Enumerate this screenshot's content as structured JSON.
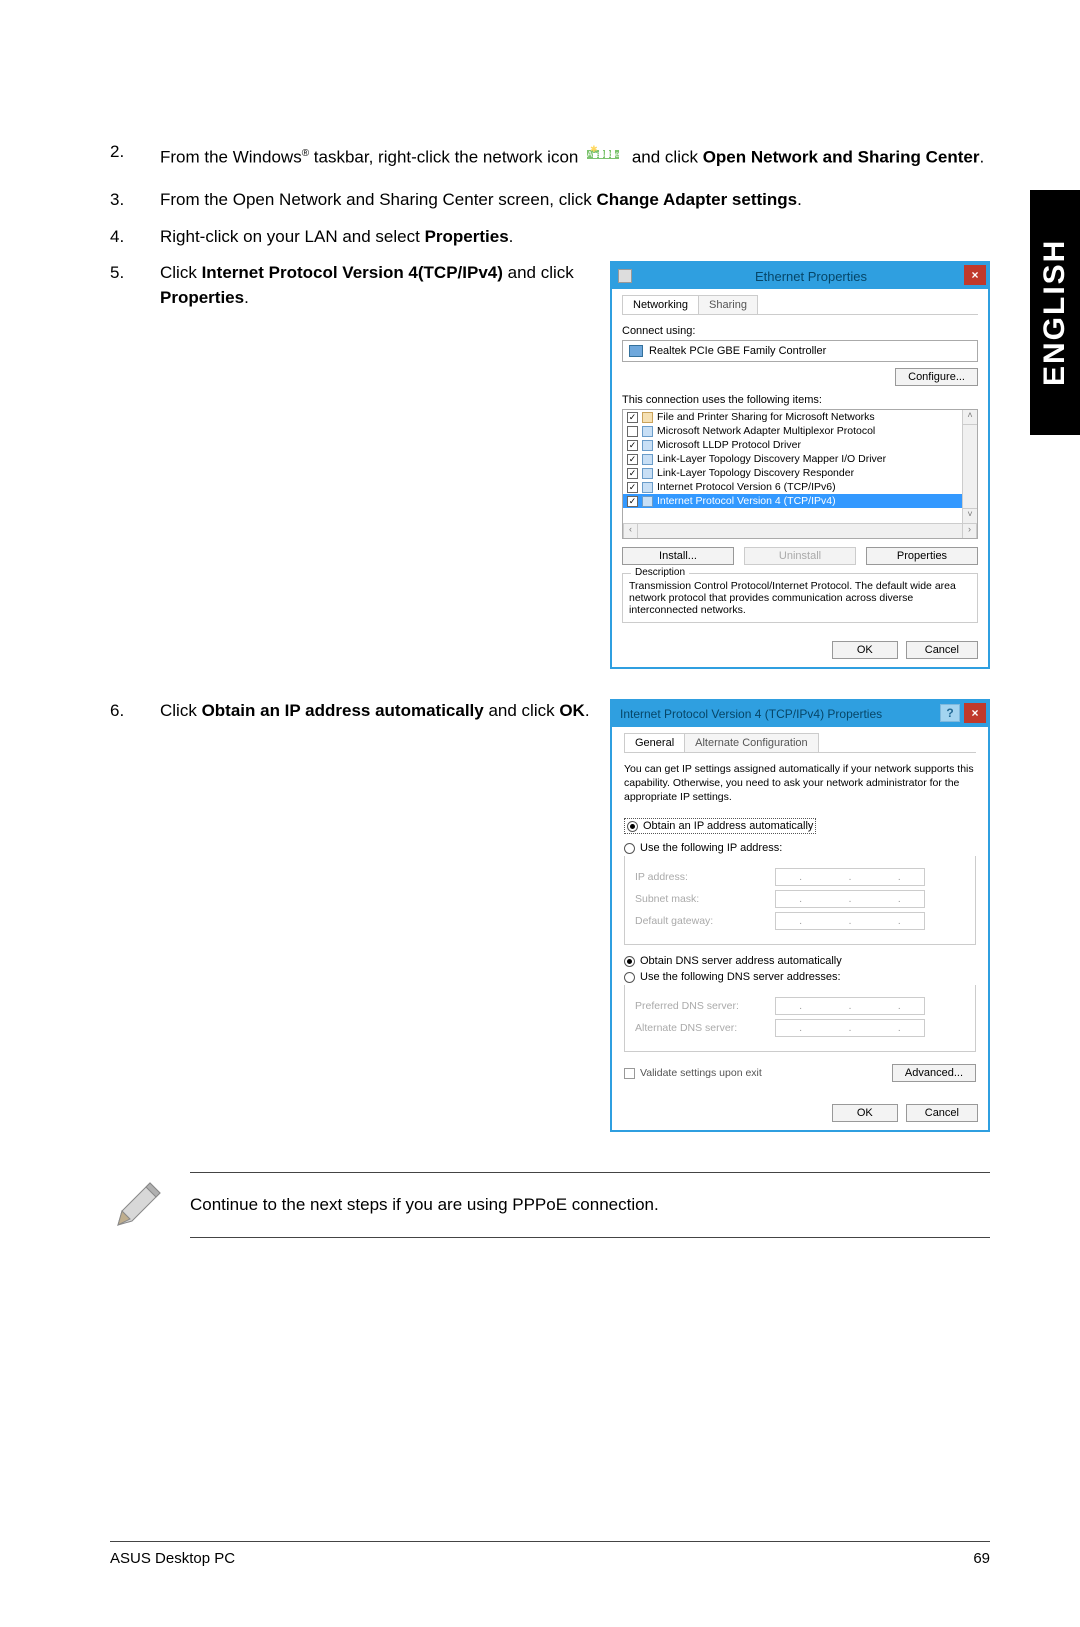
{
  "sideTab": "ENGLISH",
  "steps": {
    "s2": {
      "num": "2.",
      "pre": "From the Windows",
      "reg": "®",
      "mid": " taskbar, right-click the network icon ",
      "iconAvail": "Available",
      "post": " and click ",
      "b1": "Open Network and Sharing Center",
      "end": "."
    },
    "s3": {
      "num": "3.",
      "pre": "From the Open Network and Sharing Center screen, click ",
      "b1": "Change Adapter settings",
      "end": "."
    },
    "s4": {
      "num": "4.",
      "pre": "Right-click on your LAN and select ",
      "b1": "Properties",
      "end": "."
    },
    "s5": {
      "num": "5.",
      "pre": "Click ",
      "b1": "Internet Protocol Version 4(TCP/IPv4)",
      "mid": " and click ",
      "b2": "Properties",
      "end": "."
    },
    "s6": {
      "num": "6.",
      "pre": "Click ",
      "b1": "Obtain an IP address automatically",
      "mid": " and click ",
      "b2": "OK",
      "end": "."
    }
  },
  "dlg1": {
    "title": "Ethernet Properties",
    "tab1": "Networking",
    "tab2": "Sharing",
    "connectUsing": "Connect using:",
    "nic": "Realtek PCIe GBE Family Controller",
    "configure": "Configure...",
    "itemsLabel": "This connection uses the following items:",
    "items": [
      {
        "chk": true,
        "txt": "File and Printer Sharing for Microsoft Networks",
        "ico": "share"
      },
      {
        "chk": false,
        "txt": "Microsoft Network Adapter Multiplexor Protocol",
        "ico": "proto"
      },
      {
        "chk": true,
        "txt": "Microsoft LLDP Protocol Driver",
        "ico": "proto"
      },
      {
        "chk": true,
        "txt": "Link-Layer Topology Discovery Mapper I/O Driver",
        "ico": "proto"
      },
      {
        "chk": true,
        "txt": "Link-Layer Topology Discovery Responder",
        "ico": "proto"
      },
      {
        "chk": true,
        "txt": "Internet Protocol Version 6 (TCP/IPv6)",
        "ico": "proto"
      },
      {
        "chk": true,
        "txt": "Internet Protocol Version 4 (TCP/IPv4)",
        "ico": "proto",
        "sel": true
      }
    ],
    "install": "Install...",
    "uninstall": "Uninstall",
    "properties": "Properties",
    "descLegend": "Description",
    "descText": "Transmission Control Protocol/Internet Protocol. The default wide area network protocol that provides communication across diverse interconnected networks.",
    "ok": "OK",
    "cancel": "Cancel"
  },
  "dlg2": {
    "title": "Internet Protocol Version 4 (TCP/IPv4) Properties",
    "help": "?",
    "tab1": "General",
    "tab2": "Alternate Configuration",
    "info": "You can get IP settings assigned automatically if your network supports this capability. Otherwise, you need to ask your network administrator for the appropriate IP settings.",
    "r1": "Obtain an IP address automatically",
    "r2": "Use the following IP address:",
    "ipaddr": "IP address:",
    "subnet": "Subnet mask:",
    "gateway": "Default gateway:",
    "r3": "Obtain DNS server address automatically",
    "r4": "Use the following DNS server addresses:",
    "dns1": "Preferred DNS server:",
    "dns2": "Alternate DNS server:",
    "validate": "Validate settings upon exit",
    "advanced": "Advanced...",
    "ok": "OK",
    "cancel": "Cancel"
  },
  "note": "Continue to the next steps if you are using PPPoE connection.",
  "footer": {
    "left": "ASUS Desktop PC",
    "right": "69"
  }
}
